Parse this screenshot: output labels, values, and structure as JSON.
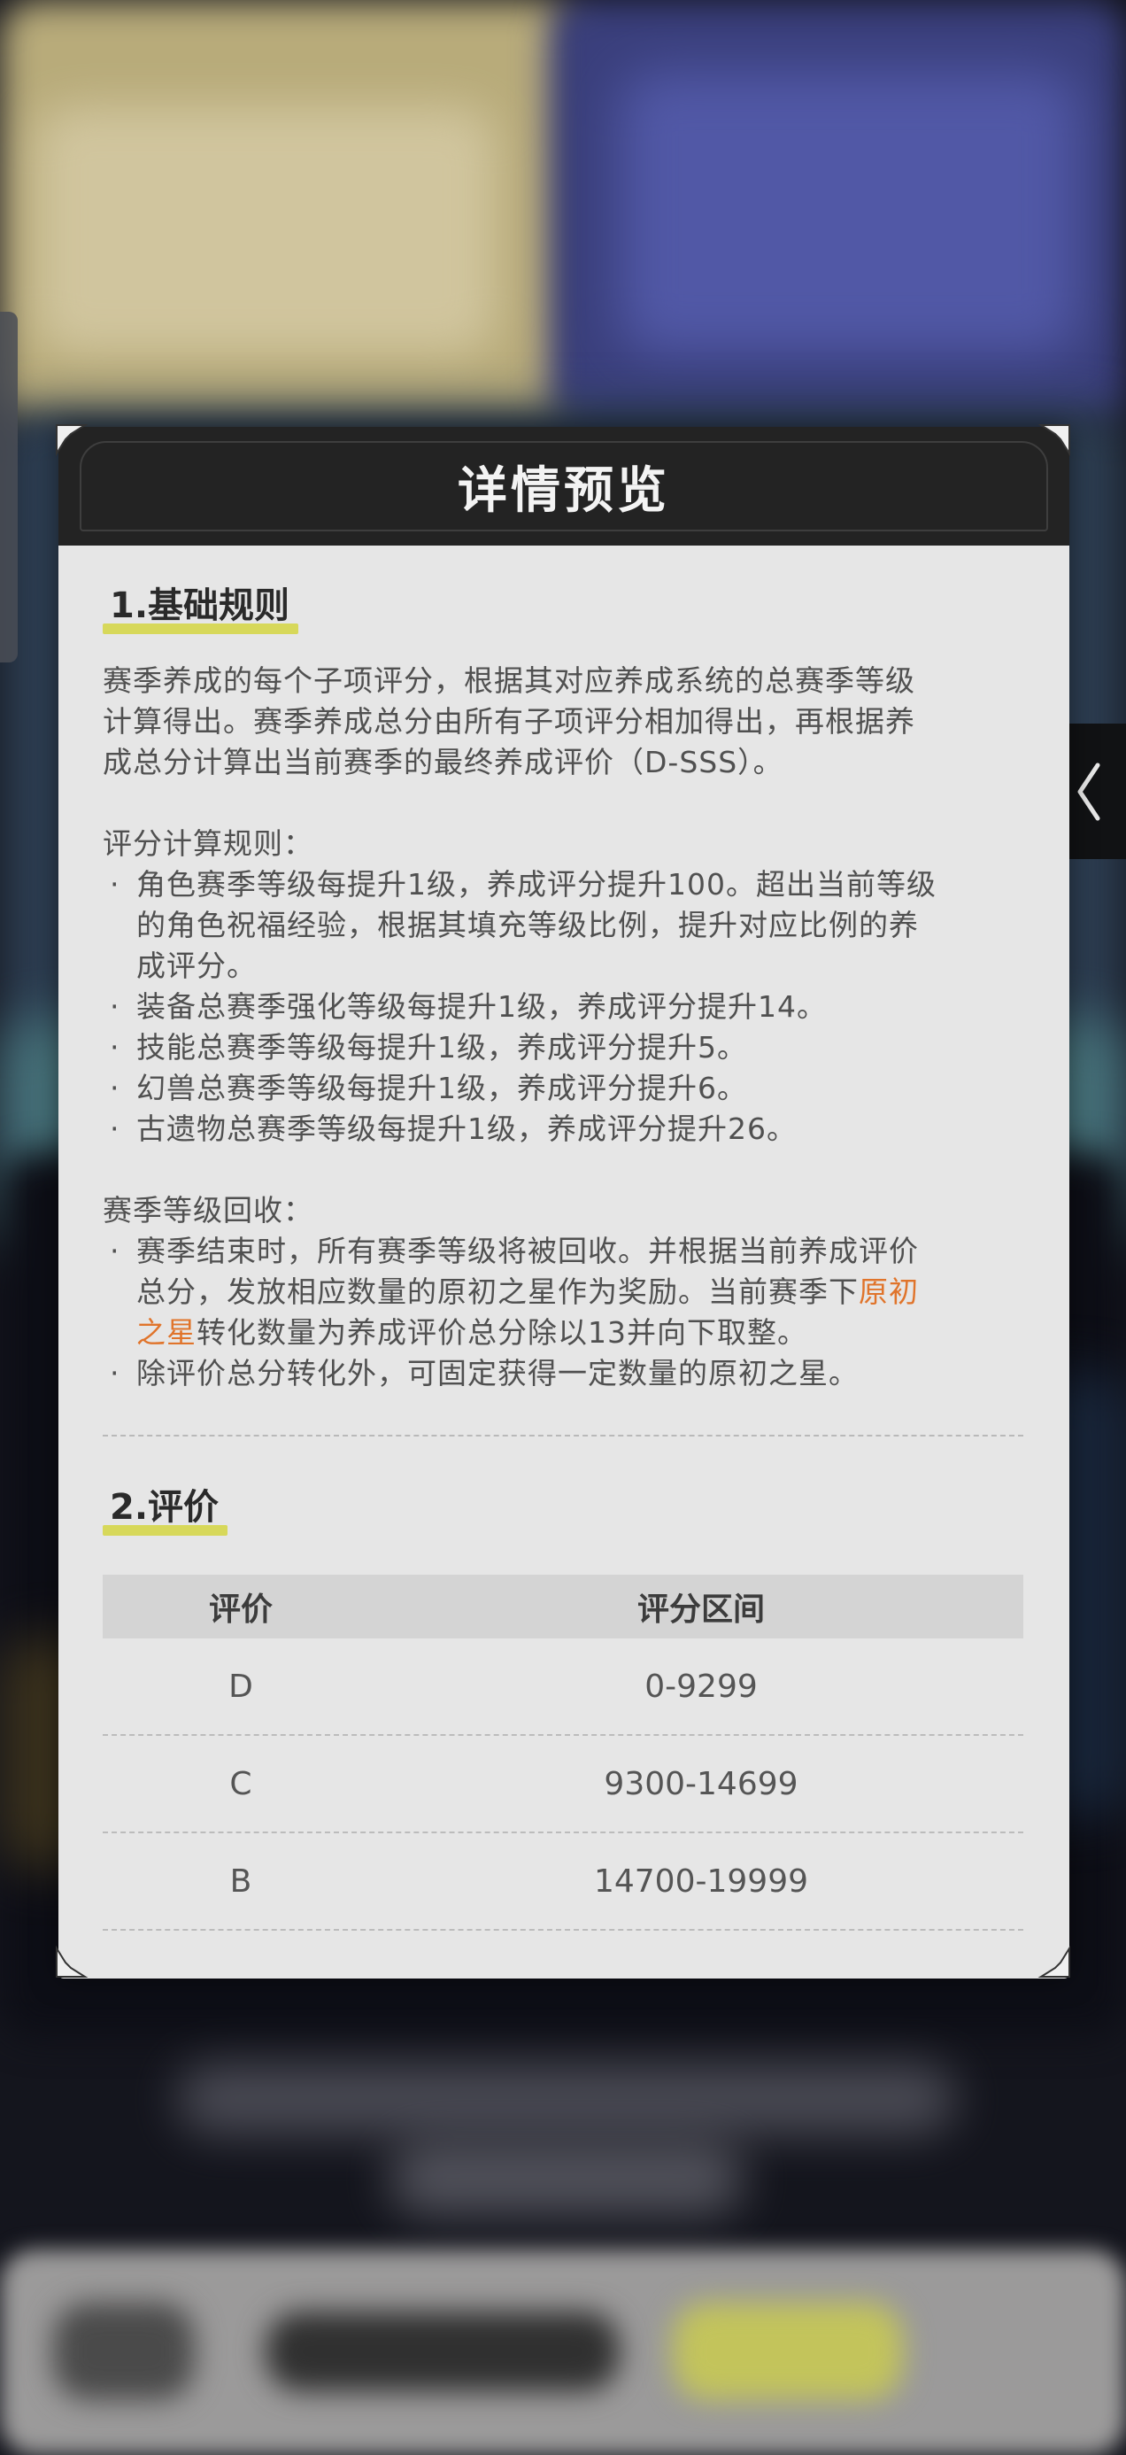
{
  "dialog": {
    "title": "详情预览",
    "section1": {
      "title": "1.基础规则",
      "intro_lines": [
        "赛季养成的每个子项评分，根据其对应养成系统的总赛季等级",
        "计算得出。赛季养成总分由所有子项评分相加得出，再根据养",
        "成总分计算出当前赛季的最终养成评价（D-SSS）。"
      ],
      "score_rules": {
        "heading": "评分计算规则：",
        "items": [
          [
            "角色赛季等级每提升1级，养成评分提升100。超出当前等级",
            "的角色祝福经验，根据其填充等级比例，提升对应比例的养",
            "成评分。"
          ],
          [
            "装备总赛季强化等级每提升1级，养成评分提升14。"
          ],
          [
            "技能总赛季等级每提升1级，养成评分提升5。"
          ],
          [
            "幻兽总赛季等级每提升1级，养成评分提升6。"
          ],
          [
            "古遗物总赛季等级每提升1级，养成评分提升26。"
          ]
        ]
      },
      "recycle": {
        "heading": "赛季等级回收：",
        "item1": {
          "line1": "赛季结束时，所有赛季等级将被回收。并根据当前养成评价",
          "line2_prefix": "总分，发放相应数量的原初之星作为奖励。当前赛季下",
          "line2_highlight": "原初",
          "line3_highlight": "之星",
          "line3_suffix": "转化数量为养成评价总分除以13并向下取整。"
        },
        "item2": "除评价总分转化外，可固定获得一定数量的原初之星。"
      }
    },
    "section2": {
      "title": "2.评价",
      "table": {
        "headers": [
          "评价",
          "评分区间"
        ],
        "rows": [
          [
            "D",
            "0-9299"
          ],
          [
            "C",
            "9300-14699"
          ],
          [
            "B",
            "14700-19999"
          ]
        ]
      }
    }
  },
  "bullet_glyph": "·",
  "colors": {
    "header_bg": "#232323",
    "panel_bg": "#e6e6e6",
    "highlight_text": "#e0742b",
    "title_underline": "#d7d85a"
  },
  "icons": {
    "side_button": "chevron-left-icon"
  }
}
